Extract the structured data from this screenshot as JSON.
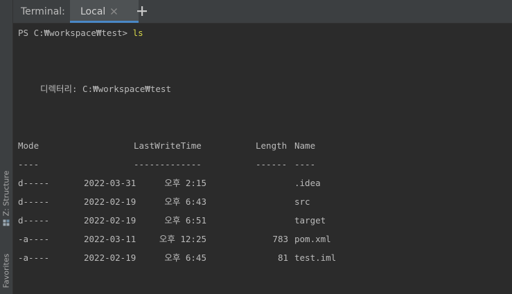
{
  "header": {
    "title": "Terminal:",
    "tabs": [
      {
        "label": "Local"
      }
    ],
    "new_tab_icon": "plus-icon"
  },
  "sidebar": {
    "tabs": [
      {
        "label": "Z: Structure",
        "icon": "structure-icon"
      },
      {
        "label": "Favorites"
      }
    ]
  },
  "terminal": {
    "prompt": "PS C:₩workspace₩test> ",
    "command": "ls",
    "directory_line": "디렉터리: C:₩workspace₩test",
    "columns": {
      "mode": "Mode",
      "lastwritetime": "LastWriteTime",
      "length": "Length",
      "name": "Name"
    },
    "separators": {
      "mode": "----",
      "lastwritetime": "-------------",
      "length": "------",
      "name": "----"
    },
    "rows": [
      {
        "mode": "d-----",
        "date": "2022-03-31",
        "time": "오후 2:15",
        "length": "",
        "name": ".idea"
      },
      {
        "mode": "d-----",
        "date": "2022-02-19",
        "time": "오후 6:43",
        "length": "",
        "name": "src"
      },
      {
        "mode": "d-----",
        "date": "2022-02-19",
        "time": "오후 6:51",
        "length": "",
        "name": "target"
      },
      {
        "mode": "-a----",
        "date": "2022-03-11",
        "time": "오후 12:25",
        "length": "783",
        "name": "pom.xml"
      },
      {
        "mode": "-a----",
        "date": "2022-02-19",
        "time": "오후 6:45",
        "length": "81",
        "name": "test.iml"
      }
    ]
  },
  "colors": {
    "background": "#2b2b2b",
    "toolbar": "#3c3f41",
    "active_tab": "#4e5254",
    "tab_underline": "#4a88c7",
    "text": "#bbbbbb",
    "command": "#d6d64a"
  }
}
